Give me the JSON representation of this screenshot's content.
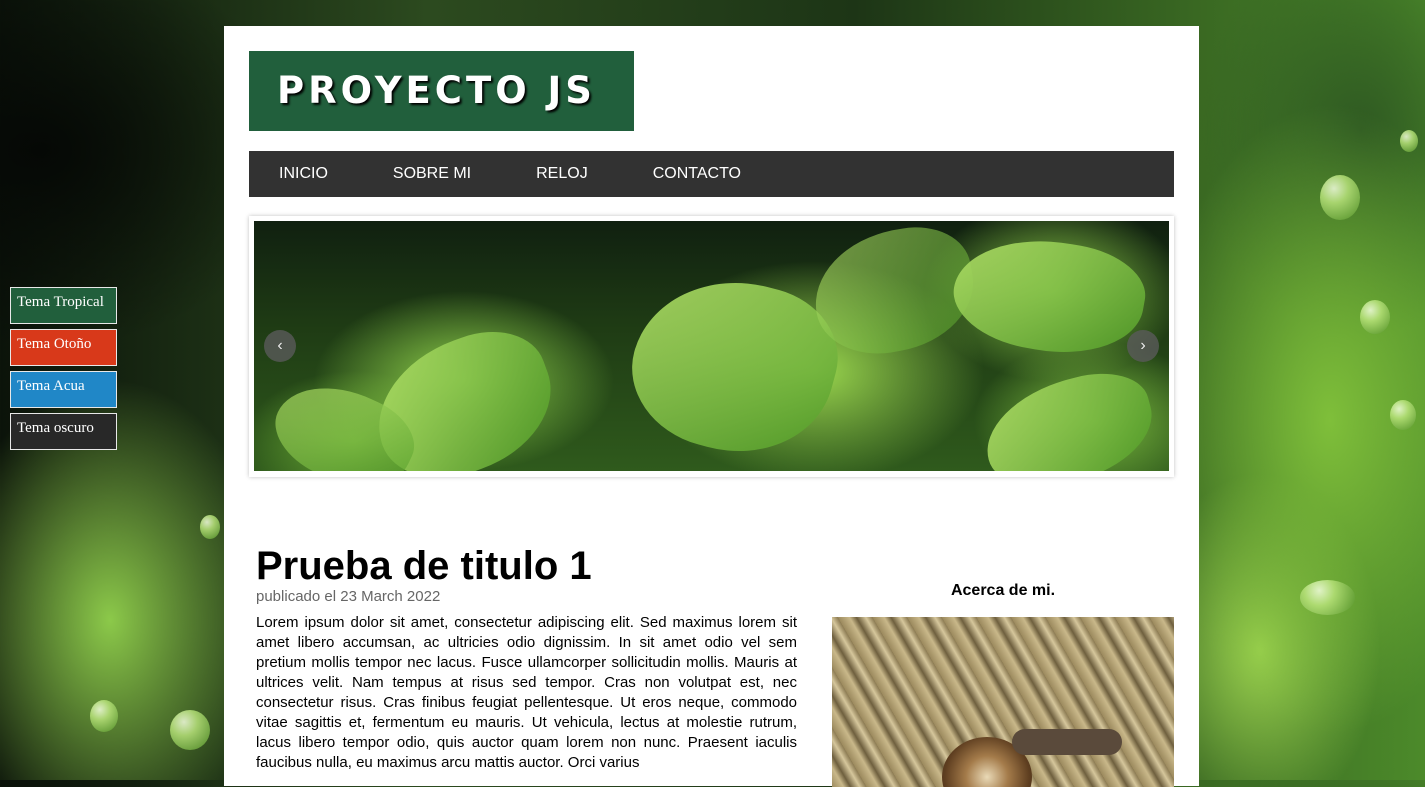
{
  "themes": [
    {
      "label": "Tema Tropical",
      "color": "#215f3c"
    },
    {
      "label": "Tema Otoño",
      "color": "#d8391a"
    },
    {
      "label": "Tema Acua",
      "color": "#2087c7"
    },
    {
      "label": "Tema oscuro",
      "color": "#282828"
    }
  ],
  "header": {
    "logo": "PROYECTO JS"
  },
  "nav": {
    "items": [
      "INICIO",
      "SOBRE MI",
      "RELOJ",
      "CONTACTO"
    ]
  },
  "slider": {
    "prev_icon": "chevron-left-icon",
    "next_icon": "chevron-right-icon",
    "prev_glyph": "‹",
    "next_glyph": "›"
  },
  "article": {
    "title": "Prueba de titulo 1",
    "meta": "publicado el 23 March 2022",
    "body": "Lorem ipsum dolor sit amet, consectetur adipiscing elit. Sed maximus lorem sit amet libero accumsan, ac ultricies odio dignissim. In sit amet odio vel sem pretium mollis tempor nec lacus. Fusce ullamcorper sollicitudin mollis. Mauris at ultrices velit. Nam tempus at risus sed tempor. Cras non volutpat est, nec consectetur risus. Cras finibus feugiat pellentesque. Ut eros neque, commodo vitae sagittis et, fermentum eu mauris. Ut vehicula, lectus at molestie rutrum, lacus libero tempor odio, quis auctor quam lorem non nunc. Praesent iaculis faucibus nulla, eu maximus arcu mattis auctor. Orci varius"
  },
  "aside": {
    "title": "Acerca de mi."
  }
}
